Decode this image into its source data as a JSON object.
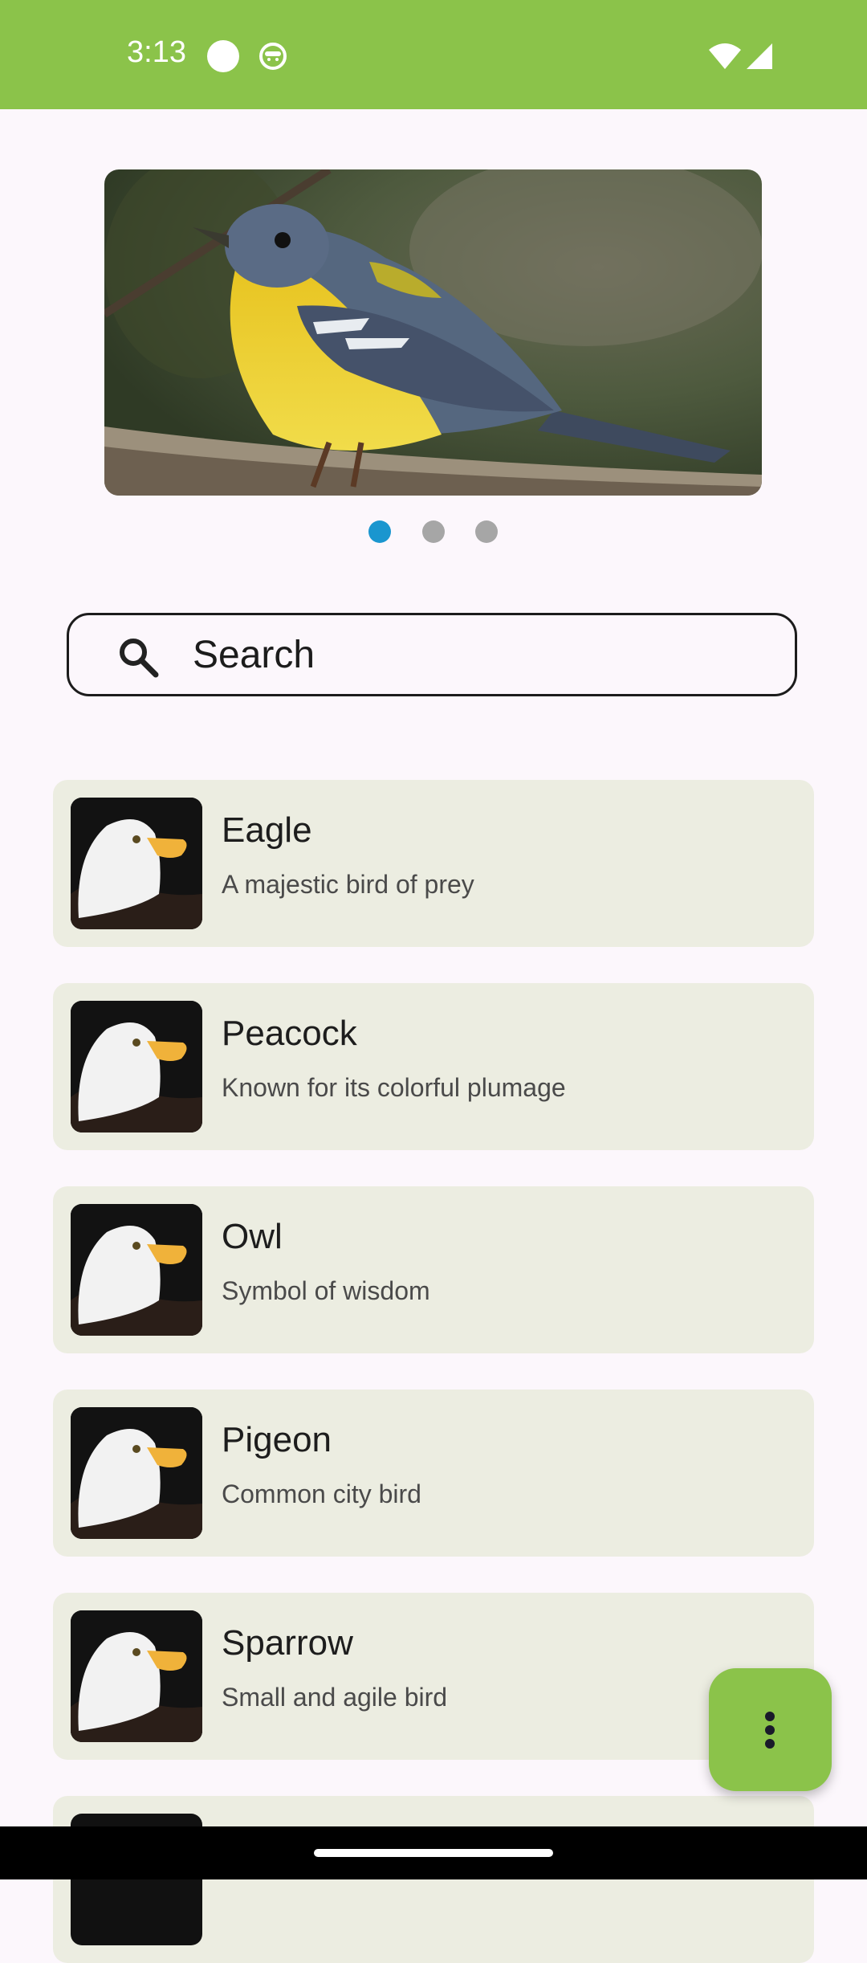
{
  "status_bar": {
    "time": "3:13",
    "bg_color": "#8BC34A",
    "icons": [
      "circle-notification-icon",
      "face-notification-icon",
      "wifi-icon",
      "signal-icon"
    ]
  },
  "carousel": {
    "image": "yellow-breasted-warbler-photo",
    "page_count": 3,
    "active_index": 0,
    "active_color": "#1A96CF",
    "inactive_color": "#A6A6A6"
  },
  "search": {
    "placeholder": "Search",
    "icon": "search-icon"
  },
  "birds": [
    {
      "name": "Eagle",
      "description": "A majestic bird of prey",
      "thumb": "eagle-photo"
    },
    {
      "name": "Peacock",
      "description": "Known for its colorful plumage",
      "thumb": "eagle-photo"
    },
    {
      "name": "Owl",
      "description": "Symbol of wisdom",
      "thumb": "eagle-photo"
    },
    {
      "name": "Pigeon",
      "description": "Common city bird",
      "thumb": "eagle-photo"
    },
    {
      "name": "Sparrow",
      "description": "Small and agile bird",
      "thumb": "eagle-photo"
    }
  ],
  "fab": {
    "icon": "more-vert-icon",
    "color": "#8BC34A"
  },
  "colors": {
    "card_bg": "#ECEDE1",
    "page_bg": "#FCF7FC"
  }
}
